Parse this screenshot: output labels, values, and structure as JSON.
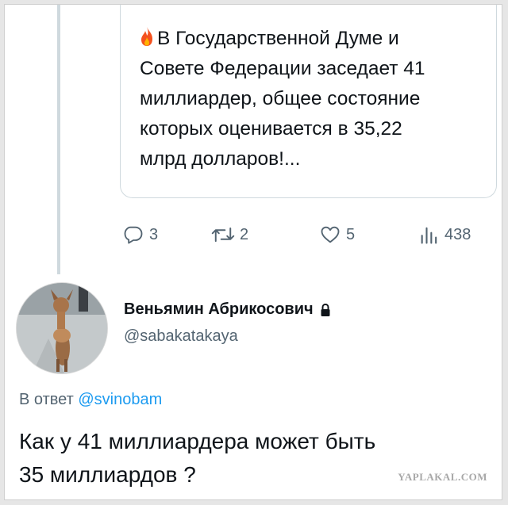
{
  "quoted_tweet": {
    "emoji": "🔥",
    "lines": [
      "В Государственной Думе и",
      "Совете Федерации заседает 41",
      "миллиардер, общее состояние",
      "которых оценивается в 35,22",
      "млрд долларов!..."
    ]
  },
  "actions": {
    "replies": "3",
    "retweets": "2",
    "likes": "5",
    "views": "438"
  },
  "reply": {
    "author_name": "Веньямин Абрикосович",
    "author_handle": "@sabakatakaya",
    "reply_to_prefix": "В ответ",
    "reply_to_handle": "@svinobam",
    "text_line1": "Как у 41 миллиардера может быть",
    "text_line2": "35 миллиардов ?"
  },
  "watermark": "YAPLAKAL.COM",
  "icons": [
    "fire-icon",
    "reply-icon",
    "retweet-icon",
    "like-icon",
    "views-icon",
    "lock-icon"
  ],
  "colors": {
    "text": "#0f1419",
    "secondary": "#536471",
    "link": "#1d9bf0",
    "border": "#cfd9de"
  }
}
